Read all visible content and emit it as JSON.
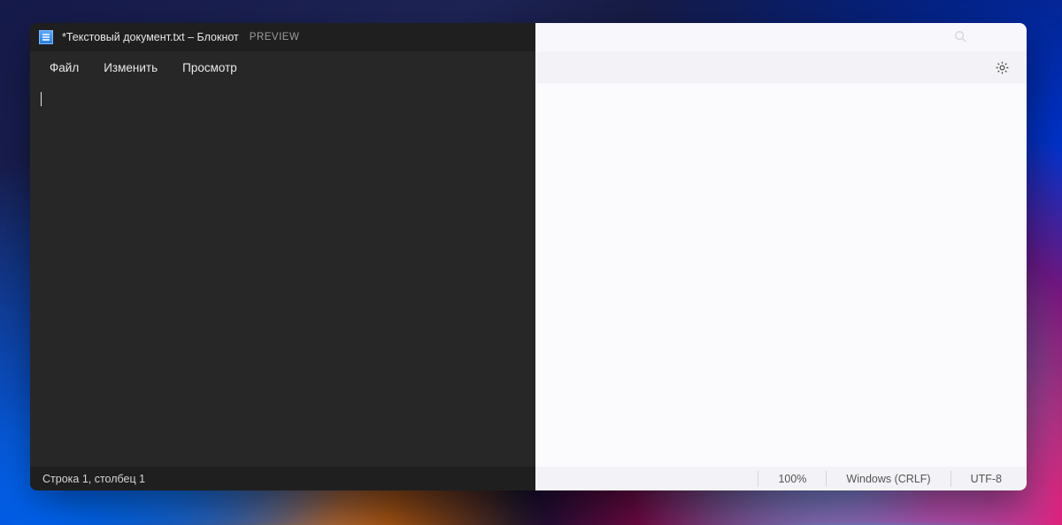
{
  "titlebar": {
    "title": "*Текстовый документ.txt – Блокнот",
    "preview_label": "PREVIEW"
  },
  "menu": {
    "file": "Файл",
    "edit": "Изменить",
    "view": "Просмотр"
  },
  "editor": {
    "content": ""
  },
  "statusbar": {
    "position": "Строка 1, столбец 1",
    "zoom": "100%",
    "line_ending": "Windows (CRLF)",
    "encoding": "UTF-8"
  }
}
